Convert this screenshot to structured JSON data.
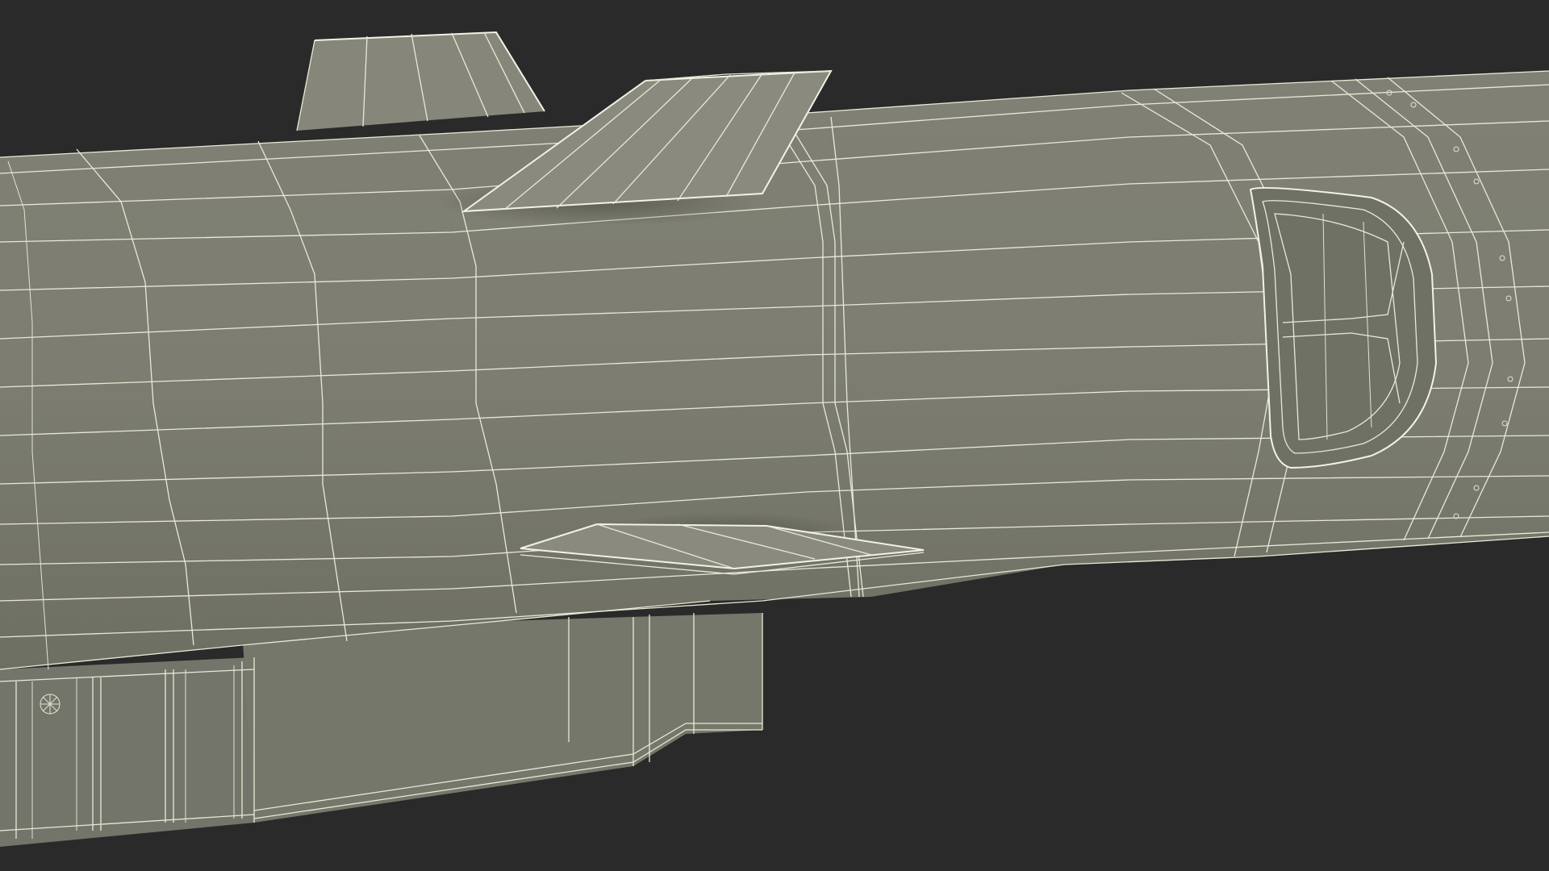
{
  "scene": {
    "subject": "wireframe-missile-model",
    "colors": {
      "background": "#2a2a2a",
      "body": "#7d7e71",
      "body_shadow": "#6a6b5f",
      "fin": "#8a8b7e",
      "wire": "#e8ead6",
      "underside": "#74756a",
      "inlet_inner": "#707165"
    }
  }
}
